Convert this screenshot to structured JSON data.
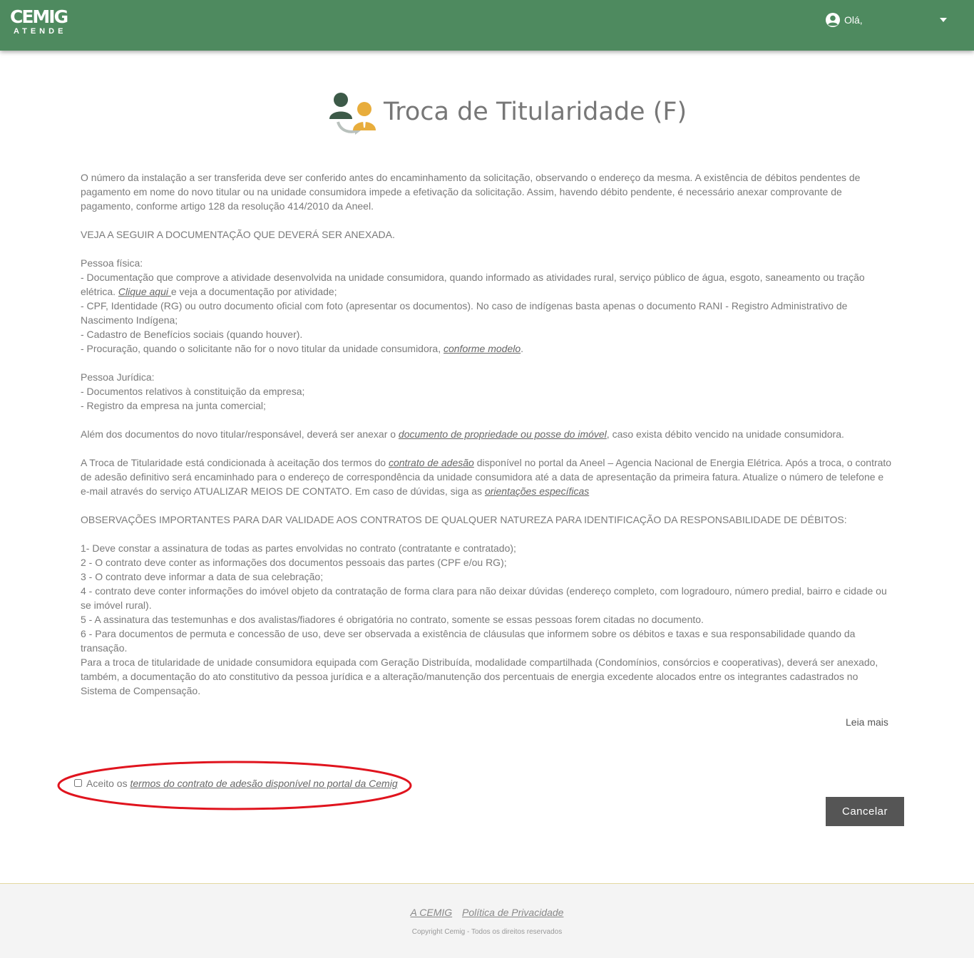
{
  "header": {
    "logo_main": "CEMIG",
    "logo_sub": "ATENDE",
    "greeting": "Olá,",
    "user_icon": "user-circle-icon",
    "menu_icon": "caret-down-icon",
    "bg_color": "#4e8a5f"
  },
  "page": {
    "title": "Troca de Titularidade (F)",
    "title_icon": "transfer-owner-icon"
  },
  "content": {
    "intro": "O número da instalação a ser transferida deve ser conferido antes do encaminhamento da solicitação, observando o endereço da mesma. A existência de débitos pendentes de pagamento em nome do novo titular ou na unidade consumidora impede a efetivação da solicitação. Assim, havendo débito pendente, é necessário anexar comprovante de pagamento, conforme artigo 128 da resolução 414/2010 da Aneel.",
    "doc_heading": "VEJA A SEGUIR A DOCUMENTAÇÃO QUE DEVERÁ SER ANEXADA.",
    "pf_title": "Pessoa física:",
    "pf_item1_a": "- Documentação que comprove a atividade desenvolvida na unidade consumidora, quando informado as atividades rural, serviço público de água, esgoto, saneamento ou tração elétrica. ",
    "pf_item1_link": "Clique aqui ",
    "pf_item1_b": "e veja a documentação por atividade;",
    "pf_item2": "- CPF, Identidade (RG) ou outro documento oficial com foto (apresentar os documentos). No caso de indígenas basta apenas o documento RANI - Registro Administrativo de Nascimento Indígena;",
    "pf_item3": "- Cadastro de Benefícios sociais (quando houver).",
    "pf_item4_a": "- Procuração, quando o solicitante não for o novo titular da unidade consumidora, ",
    "pf_item4_link": "conforme modelo",
    "pf_item4_b": ".",
    "pj_title": "Pessoa Jurídica:",
    "pj_item1": "- Documentos relativos à constituição da empresa;",
    "pj_item2": "- Registro da empresa na junta comercial;",
    "extra_a": "Além dos documentos do novo titular/responsável, deverá ser anexar o ",
    "extra_link": "documento de propriedade ou posse do imóvel",
    "extra_b": ", caso exista débito vencido na unidade consumidora.",
    "contract_a": "A Troca de Titularidade está condicionada à aceitação dos termos do ",
    "contract_link": "contrato de adesão",
    "contract_b": " disponível no portal da Aneel – Agencia Nacional de Energia Elétrica. Após a troca, o contrato de adesão definitivo será encaminhado para o endereço de correspondência da unidade consumidora até a data de apresentação da primeira fatura. Atualize o número de telefone e e-mail através do serviço ATUALIZAR MEIOS DE CONTATO. Em caso de dúvidas, siga as ",
    "contract_link2": "orientações específicas",
    "obs_heading": "OBSERVAÇÕES IMPORTANTES PARA DAR VALIDADE AOS CONTRATOS DE QUALQUER NATUREZA PARA IDENTIFICAÇÃO DA RESPONSABILIDADE DE DÉBITOS:",
    "obs_items": [
      "1- Deve constar a assinatura de todas as partes envolvidas no contrato (contratante e contratado);",
      "2 - O contrato deve conter as informações dos documentos pessoais das partes (CPF e/ou RG);",
      "3 - O contrato deve informar a data de sua celebração;",
      "4 - contrato deve conter informações do imóvel objeto da contratação de forma clara para não deixar dúvidas (endereço completo, com logradouro, número predial, bairro e cidade ou se imóvel rural).",
      "5 - A assinatura das testemunhas e dos avalistas/fiadores é obrigatória no contrato, somente se essas pessoas forem citadas no documento.",
      "6 - Para documentos de permuta e concessão de uso, deve ser observada a existência de cláusulas que informem sobre os débitos e taxas e sua responsabilidade quando da transação."
    ],
    "gd_text": "Para a troca de titularidade de unidade consumidora equipada com Geração Distribuída, modalidade compartilhada (Condomínios, consórcios e cooperativas), deverá ser anexado, também, a documentação do ato constitutivo da pessoa jurídica e a alteração/manutenção dos percentuais de energia excedente alocados entre os integrantes cadastrados no Sistema de Compensação."
  },
  "leia_mais": "Leia mais",
  "accept": {
    "prefix": "Aceito os ",
    "link": "termos do contrato de adesão disponível no portal da Cemig",
    "checked": false,
    "highlight_color": "#e0141e"
  },
  "actions": {
    "cancel": "Cancelar"
  },
  "footer": {
    "link1": "A CEMIG",
    "link2": "Política de Privacidade",
    "copyright": "Copyright Cemig - Todos os direitos reservados"
  }
}
